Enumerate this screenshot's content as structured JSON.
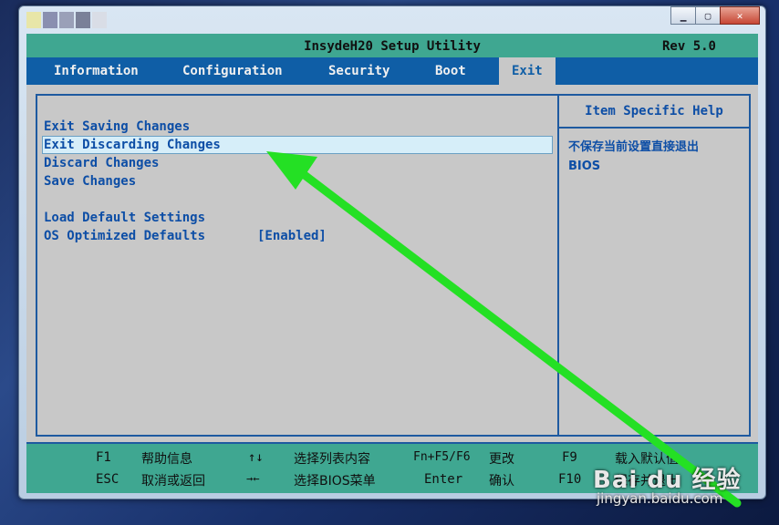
{
  "header": {
    "title": "InsydeH20 Setup Utility",
    "rev": "Rev 5.0"
  },
  "menu": [
    {
      "label": "Information"
    },
    {
      "label": "Configuration"
    },
    {
      "label": "Security"
    },
    {
      "label": "Boot"
    },
    {
      "label": "Exit",
      "active": true
    }
  ],
  "items": {
    "exit_saving": "Exit Saving Changes",
    "exit_discarding": "Exit Discarding Changes",
    "discard": "Discard Changes",
    "save": "Save Changes",
    "load_default": "Load Default Settings",
    "os_optimized": "OS Optimized Defaults",
    "os_optimized_value": "[Enabled]"
  },
  "help": {
    "title": "Item Specific Help",
    "line1": "不保存当前设置直接退出",
    "line2": "BIOS"
  },
  "footer": {
    "k1": "F1",
    "d1": "帮助信息",
    "k2": "↑↓",
    "d2": "选择列表内容",
    "k3": "Fn+F5/F6",
    "d3": "更改",
    "k4": "F9",
    "d4": "载入默认值",
    "k5": "ESC",
    "d5": "取消或返回",
    "k6": "→←",
    "d6": "选择BIOS菜单",
    "k7": "Enter",
    "d7": "确认",
    "k8": "F10",
    "d8": "保存并退出"
  },
  "watermark": {
    "brand": "Bai du 经验",
    "url": "jingyan.baidu.com"
  },
  "colors": {
    "accent": "#0f5ea6",
    "teal": "#3fa791",
    "arrow": "#22dd22"
  }
}
